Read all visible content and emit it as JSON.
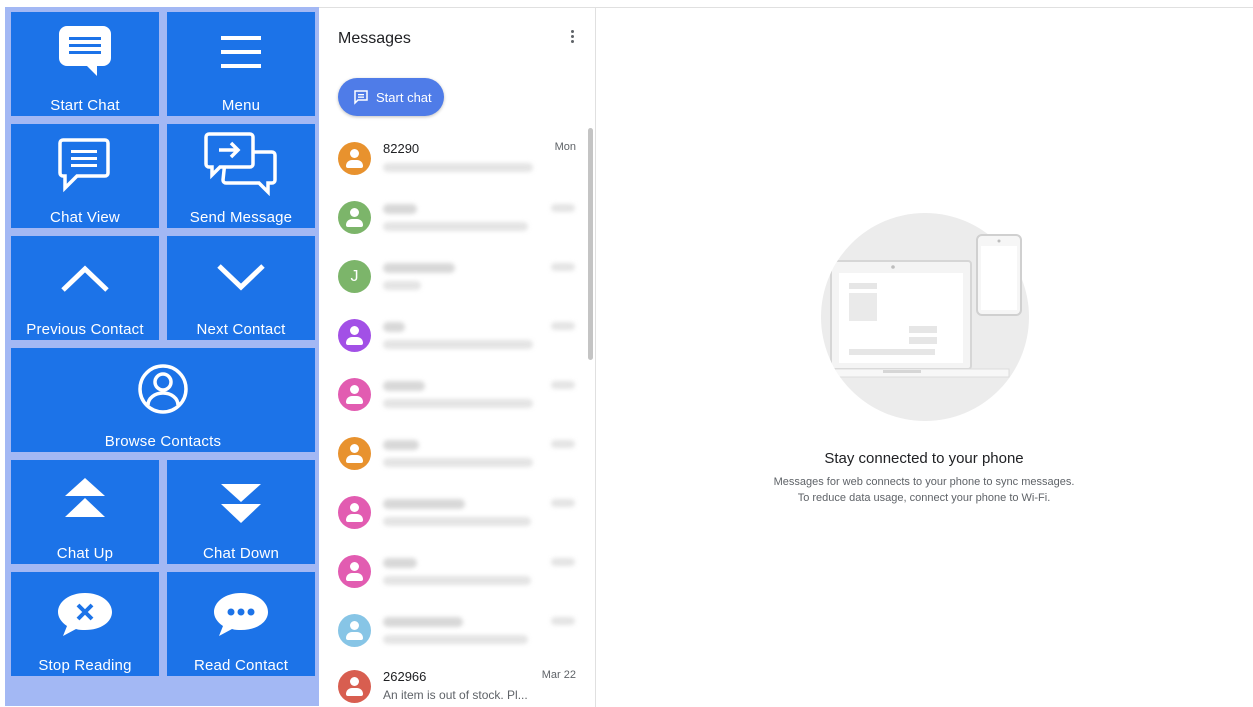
{
  "accessibility_panel": {
    "tiles": [
      {
        "label": "Start Chat",
        "icon": "chat-bubble-lines-icon"
      },
      {
        "label": "Menu",
        "icon": "hamburger-menu-icon"
      },
      {
        "label": "Chat View",
        "icon": "chat-outline-icon"
      },
      {
        "label": "Send Message",
        "icon": "send-message-icon"
      },
      {
        "label": "Previous Contact",
        "icon": "chevron-up-icon"
      },
      {
        "label": "Next Contact",
        "icon": "chevron-down-icon"
      },
      {
        "label": "Browse Contacts",
        "icon": "person-circle-icon"
      },
      {
        "label": "Chat Up",
        "icon": "double-arrow-up-icon"
      },
      {
        "label": "Chat Down",
        "icon": "double-arrow-down-icon"
      },
      {
        "label": "Stop Reading",
        "icon": "stop-bubble-icon"
      },
      {
        "label": "Read Contact",
        "icon": "ellipsis-bubble-icon"
      }
    ],
    "colors": {
      "tile": "#1c73e8",
      "background": "#a3b8f4"
    }
  },
  "messages": {
    "title": "Messages",
    "start_chat_label": "Start chat",
    "conversations": [
      {
        "name": "82290",
        "time": "Mon",
        "avatar_color": "#e8922e",
        "blurred": true
      },
      {
        "avatar_color": "#7cb56a",
        "blurred": true
      },
      {
        "avatar_color": "#7cb56a",
        "avatar_letter": "J",
        "blurred": true
      },
      {
        "avatar_color": "#a250e6",
        "blurred": true
      },
      {
        "avatar_color": "#e25cb1",
        "blurred": true
      },
      {
        "avatar_color": "#e8922e",
        "blurred": true
      },
      {
        "avatar_color": "#e25cb1",
        "blurred": true
      },
      {
        "avatar_color": "#e25cb1",
        "blurred": true
      },
      {
        "avatar_color": "#87c5e6",
        "blurred": true
      },
      {
        "name": "262966",
        "time": "Mar 22",
        "snippet": "An item is out of stock. Pl...",
        "avatar_color": "#d85e50",
        "blurred": false
      }
    ]
  },
  "empty_state": {
    "title": "Stay connected to your phone",
    "line1": "Messages for web connects to your phone to sync messages.",
    "line2": "To reduce data usage, connect your phone to Wi-Fi."
  }
}
